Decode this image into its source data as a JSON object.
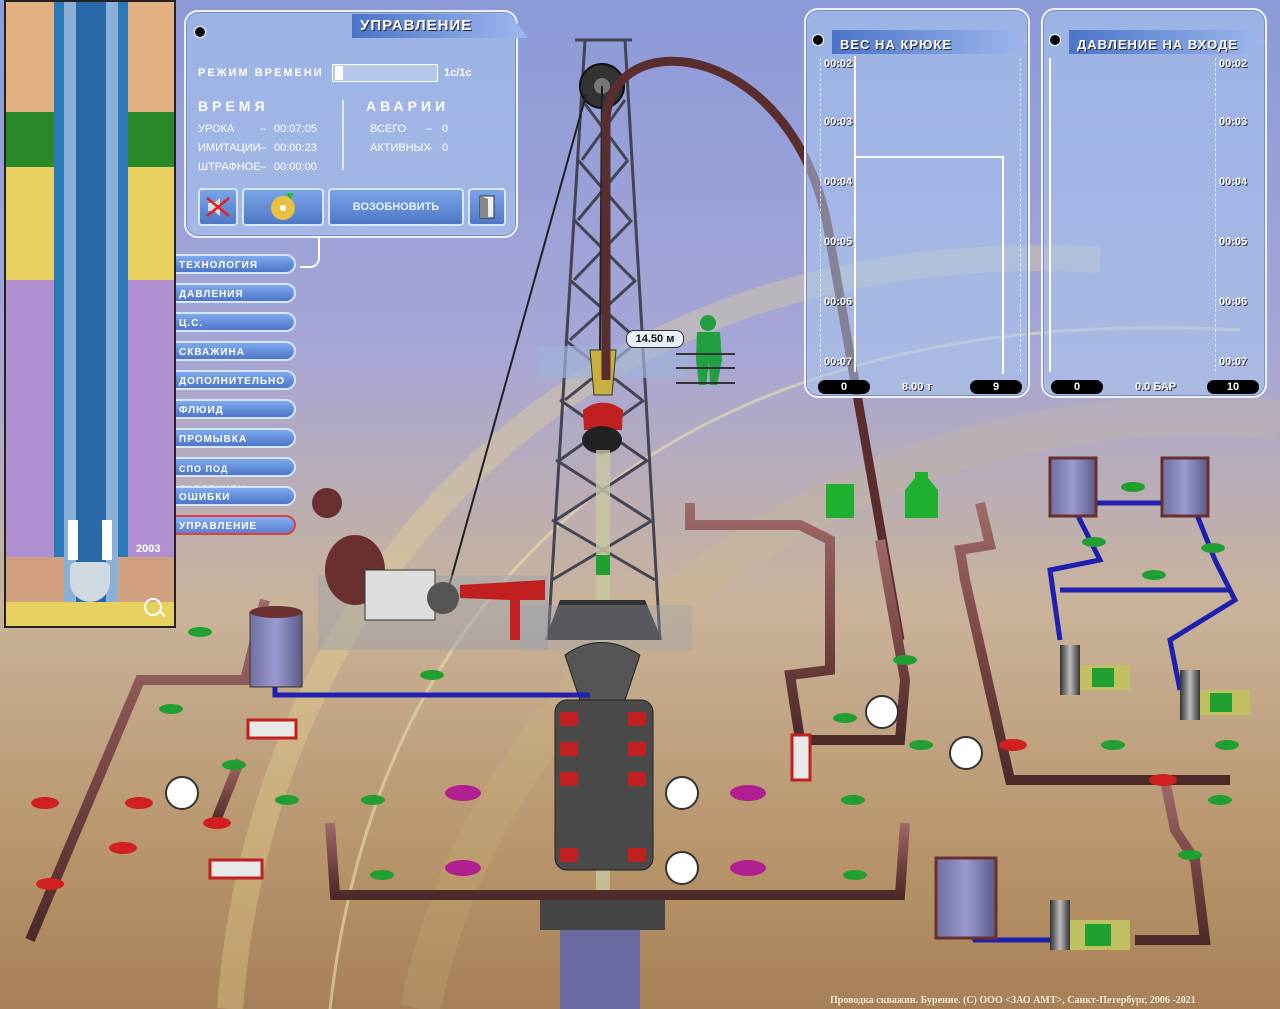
{
  "control_panel": {
    "title": "УПРАВЛЕНИЕ",
    "time_mode_label": "РЕЖИМ ВРЕМЕНИ",
    "time_mode_value": "1с/1с",
    "time_heading": "ВРЕМЯ",
    "accidents_heading": "АВАРИИ",
    "rows_time": [
      {
        "label": "УРОКА",
        "value": "00:07:05"
      },
      {
        "label": "ИМИТАЦИИ",
        "value": "00:00:23"
      },
      {
        "label": "ШТРАФНОЕ",
        "value": "00:00:00"
      }
    ],
    "rows_accidents": [
      {
        "label": "ВСЕГО",
        "value": "0"
      },
      {
        "label": "АКТИВНЫХ",
        "value": "0"
      }
    ],
    "resume_label": "ВОЗОБНОВИТЬ",
    "dash": "–"
  },
  "menu": [
    {
      "label": "ТЕХНОЛОГИЯ"
    },
    {
      "label": "ДАВЛЕНИЯ"
    },
    {
      "label": "Ц.С."
    },
    {
      "label": "СКВАЖИНА"
    },
    {
      "label": "ДОПОЛНИТЕЛЬНО"
    },
    {
      "label": "ФЛЮИД"
    },
    {
      "label": "ПРОМЫВКА"
    },
    {
      "label": "СПО ПОД ДАВЛЕНИЕМ"
    },
    {
      "label": "ОШИБКИ"
    },
    {
      "label": "УПРАВЛЕНИЕ",
      "active": true
    }
  ],
  "hook_gauge": {
    "title": "ВЕС НА КРЮКЕ",
    "times": [
      "00:02",
      "00:03",
      "00:04",
      "00:05",
      "00:06",
      "00:07"
    ],
    "min": "0",
    "max": "9",
    "current": "8.00 т"
  },
  "pressure_gauge": {
    "title": "ДАВЛЕНИЕ НА ВХОДЕ",
    "times": [
      "00:02",
      "00:03",
      "00:04",
      "00:05",
      "00:06",
      "00:07"
    ],
    "min": "0",
    "max": "10",
    "current": "0.0 БАР"
  },
  "well_depth": "2003",
  "block_depth": "14.50 м",
  "footer": "Проводка скважин. Бурение. (С) ООО <ЗАО АМТ>, Санкт-Петербург, 2006 -2021",
  "colors": {
    "pipe": "#7a4a4a",
    "water": "#2020b0",
    "valve_green": "#20a030",
    "valve_red": "#d02020",
    "valve_magenta": "#b02090"
  }
}
